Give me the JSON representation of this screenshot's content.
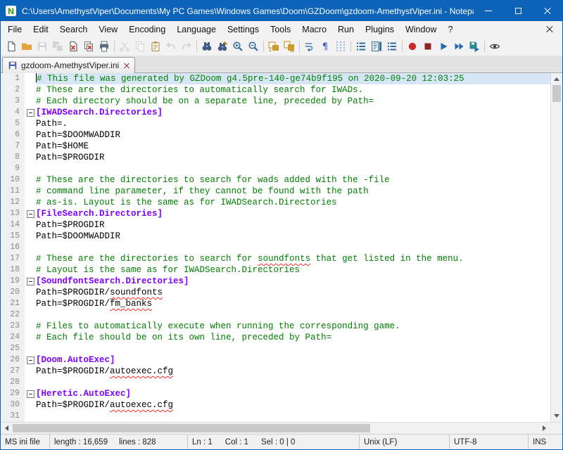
{
  "window": {
    "title": "C:\\Users\\AmethystViper\\Documents\\My PC Games\\Windows Games\\Doom\\GZDoom\\gzdoom-AmethystViper.ini - Notepad++",
    "controls": [
      "minimize",
      "maximize",
      "close"
    ]
  },
  "menu": {
    "items": [
      "File",
      "Edit",
      "Search",
      "View",
      "Encoding",
      "Language",
      "Settings",
      "Tools",
      "Macro",
      "Run",
      "Plugins",
      "Window",
      "?"
    ]
  },
  "toolbar": [
    {
      "name": "new-file",
      "shape": "page",
      "color": "#6f6f6f"
    },
    {
      "name": "open-file",
      "shape": "folder",
      "color": "#e7a33a"
    },
    {
      "name": "save-file",
      "shape": "floppy",
      "color": "#b0b0b0",
      "disabled": true
    },
    {
      "name": "save-all",
      "shape": "floppy-all",
      "color": "#b0b0b0",
      "disabled": true
    },
    {
      "name": "close-file",
      "shape": "page-x",
      "color": "#6f6f6f"
    },
    {
      "name": "close-all",
      "shape": "pages-x",
      "color": "#6f6f6f"
    },
    {
      "name": "print",
      "shape": "printer",
      "color": "#5c6e7e"
    },
    {
      "sep": true
    },
    {
      "name": "cut",
      "shape": "scissors",
      "color": "#b0b0b0",
      "disabled": true
    },
    {
      "name": "copy",
      "shape": "copy",
      "color": "#b0b0b0",
      "disabled": true
    },
    {
      "name": "paste",
      "shape": "clipboard",
      "color": "#b5924f"
    },
    {
      "name": "undo",
      "shape": "undo",
      "color": "#b0b0b0",
      "disabled": true
    },
    {
      "name": "redo",
      "shape": "redo",
      "color": "#b0b0b0",
      "disabled": true
    },
    {
      "sep": true
    },
    {
      "name": "find",
      "shape": "binoculars",
      "color": "#3f5a86"
    },
    {
      "name": "replace",
      "shape": "binoculars-pencil",
      "color": "#3f5a86"
    },
    {
      "name": "zoom-in",
      "shape": "zoom-in",
      "color": "#34699c"
    },
    {
      "name": "zoom-out",
      "shape": "zoom-out",
      "color": "#34699c"
    },
    {
      "sep": true
    },
    {
      "name": "sync-vertical-scrolling",
      "shape": "sync-v",
      "color": "#cf9a2f"
    },
    {
      "name": "sync-horizontal-scrolling",
      "shape": "sync-h",
      "color": "#cf9a2f"
    },
    {
      "sep": true
    },
    {
      "name": "word-wrap",
      "shape": "wrap",
      "color": "#3d7ab8"
    },
    {
      "name": "show-all-characters",
      "shape": "pilcrow",
      "color": "#3a56c0"
    },
    {
      "name": "show-indent-guide",
      "shape": "indent",
      "color": "#3d7ab8"
    },
    {
      "sep": true
    },
    {
      "name": "function-list",
      "shape": "list",
      "color": "#30699f"
    },
    {
      "name": "document-map",
      "shape": "map",
      "color": "#30699f"
    },
    {
      "name": "document-list",
      "shape": "list",
      "color": "#30699f"
    },
    {
      "sep": true
    },
    {
      "name": "start-recording",
      "shape": "record",
      "color": "#cc2b2b"
    },
    {
      "name": "stop-recording",
      "shape": "stop",
      "color": "#8f2424"
    },
    {
      "name": "playback-macro",
      "shape": "play",
      "color": "#2468b0"
    },
    {
      "name": "run-macro-multiple-times",
      "shape": "play-multi",
      "color": "#2468b0"
    },
    {
      "name": "save-recorded-macro",
      "shape": "floppy-play",
      "color": "#2c8c8c"
    },
    {
      "sep": true
    },
    {
      "name": "monitoring",
      "shape": "eye",
      "color": "#474747"
    }
  ],
  "tabs": [
    {
      "label": "gzdoom-AmethystViper.ini",
      "active": true,
      "saved": true
    }
  ],
  "editor": {
    "current_line": 1,
    "lines": [
      {
        "n": 1,
        "fold": false,
        "t": [
          [
            "c",
            "# This file was generated by GZDoom g4.5pre-140-ge74b9f195 on 2020-09-20 12:03:25"
          ]
        ]
      },
      {
        "n": 2,
        "fold": false,
        "t": [
          [
            "c",
            "# These are the directories to automatically search for IWADs."
          ]
        ]
      },
      {
        "n": 3,
        "fold": false,
        "t": [
          [
            "c",
            "# Each directory should be on a separate line, preceded by Path="
          ]
        ]
      },
      {
        "n": 4,
        "fold": true,
        "t": [
          [
            "s",
            "[IWADSearch.Directories]"
          ]
        ]
      },
      {
        "n": 5,
        "fold": false,
        "t": [
          [
            "d",
            "Path=."
          ]
        ]
      },
      {
        "n": 6,
        "fold": false,
        "t": [
          [
            "d",
            "Path=$DOOMWADDIR"
          ]
        ]
      },
      {
        "n": 7,
        "fold": false,
        "t": [
          [
            "d",
            "Path=$HOME"
          ]
        ]
      },
      {
        "n": 8,
        "fold": false,
        "t": [
          [
            "d",
            "Path=$PROGDIR"
          ]
        ]
      },
      {
        "n": 9,
        "fold": false,
        "t": []
      },
      {
        "n": 10,
        "fold": false,
        "t": [
          [
            "c",
            "# These are the directories to search for wads added with the -file"
          ]
        ]
      },
      {
        "n": 11,
        "fold": false,
        "t": [
          [
            "c",
            "# command line parameter, if they cannot be found with the path"
          ]
        ]
      },
      {
        "n": 12,
        "fold": false,
        "t": [
          [
            "c",
            "# as-is. Layout is the same as for IWADSearch.Directories"
          ]
        ]
      },
      {
        "n": 13,
        "fold": true,
        "t": [
          [
            "s",
            "[FileSearch.Directories]"
          ]
        ]
      },
      {
        "n": 14,
        "fold": false,
        "t": [
          [
            "d",
            "Path=$PROGDIR"
          ]
        ]
      },
      {
        "n": 15,
        "fold": false,
        "t": [
          [
            "d",
            "Path=$DOOMWADDIR"
          ]
        ]
      },
      {
        "n": 16,
        "fold": false,
        "t": []
      },
      {
        "n": 17,
        "fold": false,
        "t": [
          [
            "c",
            "# These are the directories to search for "
          ],
          [
            "cu",
            "soundfonts"
          ],
          [
            "c",
            " that get listed in the menu."
          ]
        ]
      },
      {
        "n": 18,
        "fold": false,
        "t": [
          [
            "c",
            "# Layout is the same as for IWADSearch.Directories"
          ]
        ]
      },
      {
        "n": 19,
        "fold": true,
        "t": [
          [
            "s",
            "[SoundfontSearch.Directories]"
          ]
        ]
      },
      {
        "n": 20,
        "fold": false,
        "t": [
          [
            "d",
            "Path=$PROGDIR/"
          ],
          [
            "du",
            "soundfonts"
          ]
        ]
      },
      {
        "n": 21,
        "fold": false,
        "t": [
          [
            "d",
            "Path=$PROGDIR/"
          ],
          [
            "du",
            "fm_banks"
          ]
        ]
      },
      {
        "n": 22,
        "fold": false,
        "t": []
      },
      {
        "n": 23,
        "fold": false,
        "t": [
          [
            "c",
            "# Files to automatically execute when running the corresponding game."
          ]
        ]
      },
      {
        "n": 24,
        "fold": false,
        "t": [
          [
            "c",
            "# Each file should be on its own line, preceded by Path="
          ]
        ]
      },
      {
        "n": 25,
        "fold": false,
        "t": []
      },
      {
        "n": 26,
        "fold": true,
        "t": [
          [
            "s",
            "[Doom.AutoExec]"
          ]
        ]
      },
      {
        "n": 27,
        "fold": false,
        "t": [
          [
            "d",
            "Path=$PROGDIR/"
          ],
          [
            "du",
            "autoexec.cfg"
          ]
        ]
      },
      {
        "n": 28,
        "fold": false,
        "t": []
      },
      {
        "n": 29,
        "fold": true,
        "t": [
          [
            "s",
            "[Heretic.AutoExec]"
          ]
        ]
      },
      {
        "n": 30,
        "fold": false,
        "t": [
          [
            "d",
            "Path=$PROGDIR/"
          ],
          [
            "du",
            "autoexec.cfg"
          ]
        ]
      },
      {
        "n": 31,
        "fold": false,
        "t": []
      }
    ]
  },
  "statusbar": {
    "doc_type": "MS ini file",
    "length_label": "length : 16,659",
    "lines_label": "lines : 828",
    "ln_label": "Ln : 1",
    "col_label": "Col : 1",
    "sel_label": "Sel : 0 | 0",
    "eol": "Unix (LF)",
    "encoding": "UTF-8",
    "insert_mode": "INS"
  },
  "colors": {
    "titlebar": "#0d63b8",
    "comment": "#008000",
    "section": "#8000ff",
    "default": "#000000",
    "squiggle": "#ff2a2a",
    "curline": "#d7e6f6"
  }
}
